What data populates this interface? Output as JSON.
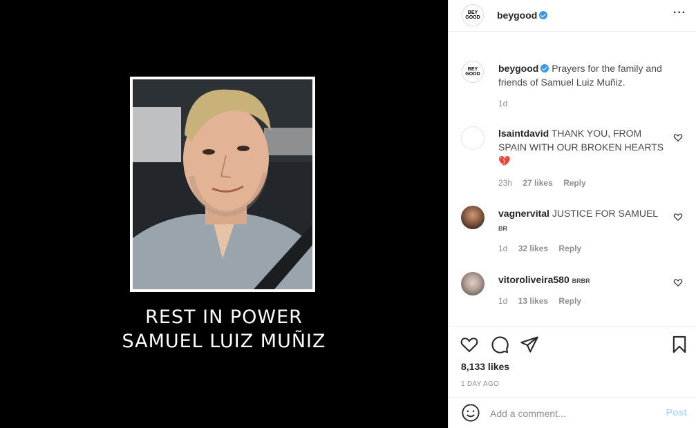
{
  "media": {
    "caption_line1": "REST IN POWER",
    "caption_line2": "SAMUEL LUIZ MUÑIZ"
  },
  "header": {
    "username": "beygood",
    "logo_text": "BEY\nGOOD",
    "more_label": "···"
  },
  "post": {
    "username": "beygood",
    "caption": "Prayers for the family and friends of Samuel Luiz Muñiz.",
    "time": "1d"
  },
  "comments": [
    {
      "username": "lsaintdavid",
      "text": "THANK YOU, FROM SPAIN WITH OUR BROKEN HEARTS",
      "emoji": "💔",
      "time": "23h",
      "likes": "27 likes",
      "reply": "Reply"
    },
    {
      "username": "vagnervital",
      "text": "JUSTICE FOR SAMUEL",
      "tag": "BR",
      "time": "1d",
      "likes": "32 likes",
      "reply": "Reply"
    },
    {
      "username": "vitoroliveira580",
      "tag": "BRBR",
      "time": "1d",
      "likes": "13 likes",
      "reply": "Reply"
    }
  ],
  "actions": {
    "likes": "8,133 likes",
    "date": "1 DAY AGO"
  },
  "composer": {
    "placeholder": "Add a comment...",
    "post_label": "Post"
  },
  "colors": {
    "verified": "#3897f0",
    "post_button_disabled": "#b3dbff",
    "media_background": "#000000"
  }
}
